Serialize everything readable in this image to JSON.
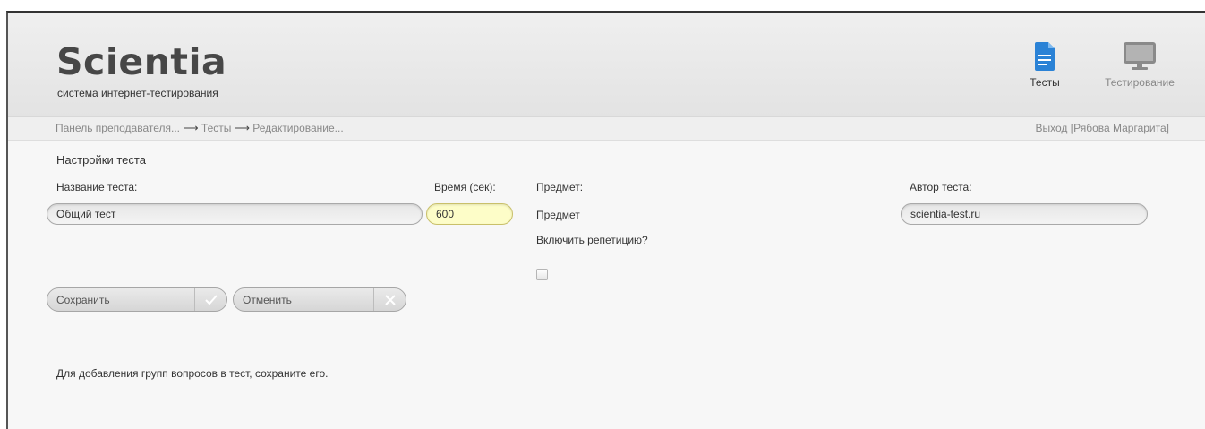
{
  "header": {
    "logo": "Scientia",
    "subtitle": "система интернет-тестирования",
    "nav": [
      {
        "label": "Тесты",
        "icon": "document-icon",
        "color": "#2a82d6"
      },
      {
        "label": "Тестирование",
        "icon": "monitor-icon",
        "color": "#8a8a8a"
      }
    ]
  },
  "breadcrumb": {
    "items": [
      "Панель преподавателя...",
      "Тесты",
      "Редактирование..."
    ],
    "separator": "⟶"
  },
  "user": {
    "logout": "Выход [Рябова Маргарита]"
  },
  "form": {
    "section_title": "Настройки теста",
    "name_label": "Название теста:",
    "name_value": "Общий тест",
    "time_label": "Время (сек):",
    "time_value": "600",
    "subject_label": "Предмет:",
    "subject_value": "Предмет",
    "repetition_label": "Включить репетицию?",
    "repetition_checked": false,
    "author_label": "Автор теста:",
    "author_value": "scientia-test.ru"
  },
  "buttons": {
    "save": "Сохранить",
    "cancel": "Отменить"
  },
  "note": "Для добавления групп вопросов в тест, сохраните его."
}
